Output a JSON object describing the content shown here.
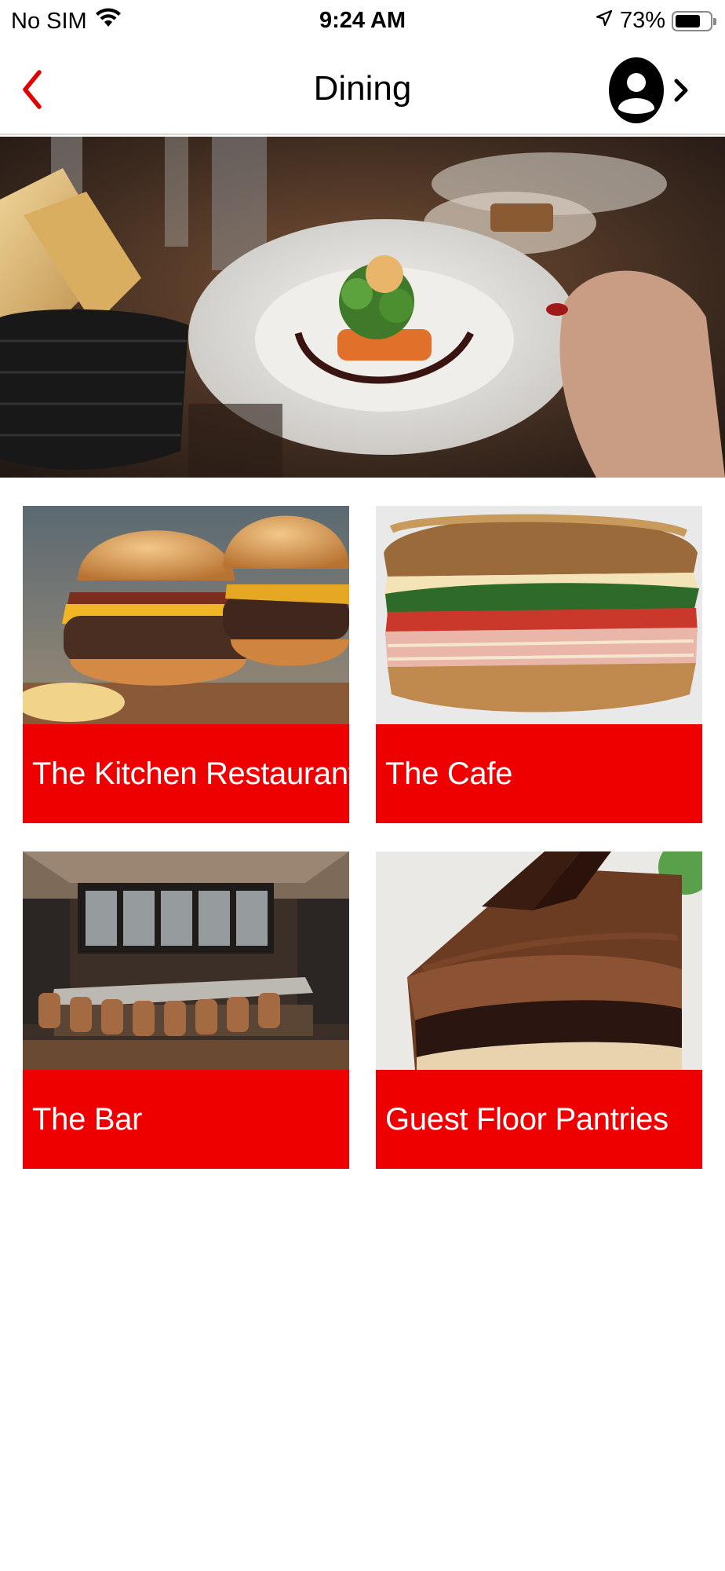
{
  "status_bar": {
    "carrier": "No SIM",
    "time": "9:24 AM",
    "battery_percent": "73%",
    "battery_level": 0.73,
    "icons": [
      "wifi-icon",
      "location-arrow-icon",
      "battery-icon"
    ]
  },
  "nav": {
    "title": "Dining",
    "back_icon": "chevron-left-icon",
    "profile_icon": "user-avatar-icon",
    "profile_chevron": "chevron-right-icon"
  },
  "hero": {
    "image": "plated-dish-photo"
  },
  "venues": [
    {
      "label": "The Kitchen Restaurant",
      "image": "burger-photo"
    },
    {
      "label": "The Cafe",
      "image": "sandwich-photo"
    },
    {
      "label": "The Bar",
      "image": "bar-interior-photo"
    },
    {
      "label": "Guest Floor Pantries",
      "image": "chocolate-cake-photo"
    }
  ],
  "colors": {
    "accent": "#ee0000",
    "back_chevron": "#e00000",
    "label_text": "#ffffff"
  }
}
